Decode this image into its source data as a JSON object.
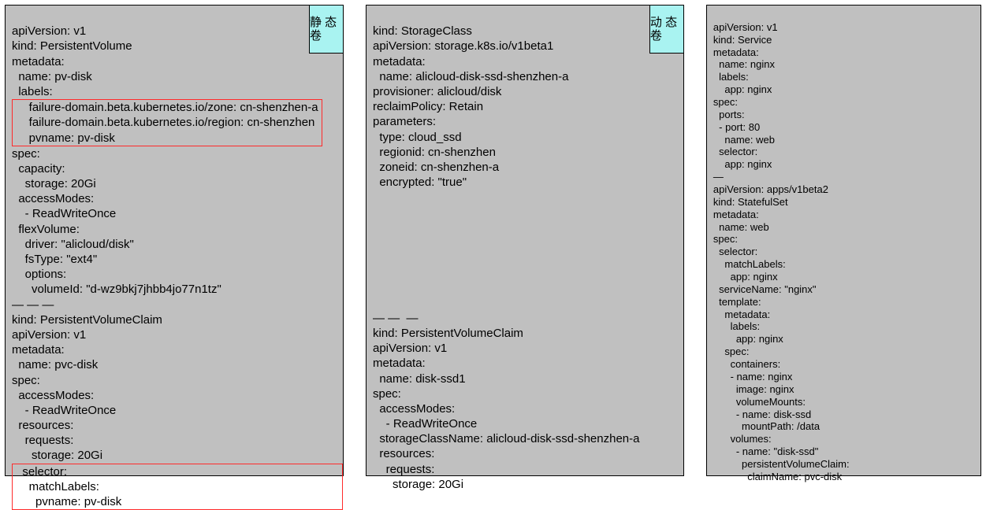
{
  "panel1": {
    "badge": "静\n态\n卷",
    "line01": "apiVersion: v1",
    "line02": "kind: PersistentVolume",
    "line03": "metadata:",
    "line04": "  name: pv-disk",
    "line05": "  labels:",
    "hl1a": "    failure-domain.beta.kubernetes.io/zone: cn-shenzhen-a",
    "hl1b": "    failure-domain.beta.kubernetes.io/region: cn-shenzhen",
    "hl1c": "    pvname: pv-disk",
    "line06": "spec:",
    "line07": "  capacity:",
    "line08": "    storage: 20Gi",
    "line09": "  accessModes:",
    "line10": "    - ReadWriteOnce",
    "line11": "  flexVolume:",
    "line12": "    driver: \"alicloud/disk\"",
    "line13": "    fsType: \"ext4\"",
    "line14": "    options:",
    "line15": "      volumeId: \"d-wz9bkj7jhbb4jo77n1tz\"",
    "sep1": "— — —",
    "line16": "kind: PersistentVolumeClaim",
    "line17": "apiVersion: v1",
    "line18": "metadata:",
    "line19": "  name: pvc-disk",
    "line20": "spec:",
    "line21": "  accessModes:",
    "line22": "    - ReadWriteOnce",
    "line23": "  resources:",
    "line24": "    requests:",
    "line25": "      storage: 20Gi",
    "hl2a": "  selector:",
    "hl2b": "    matchLabels:",
    "hl2c": "      pvname: pv-disk"
  },
  "panel2": {
    "badge": "动\n态\n卷",
    "line01": "kind: StorageClass",
    "line02": "apiVersion: storage.k8s.io/v1beta1",
    "line03": "metadata:",
    "line04": "  name: alicloud-disk-ssd-shenzhen-a",
    "line05": "provisioner: alicloud/disk",
    "line06": "reclaimPolicy: Retain",
    "line07": "parameters:",
    "line08": "  type: cloud_ssd",
    "line09": "  regionid: cn-shenzhen",
    "line10": "  zoneid: cn-shenzhen-a",
    "line11": "  encrypted: \"true\"",
    "sep1": "— —  —",
    "line12": "kind: PersistentVolumeClaim",
    "line13": "apiVersion: v1",
    "line14": "metadata:",
    "line15": "  name: disk-ssd1",
    "line16": "spec:",
    "line17": "  accessModes:",
    "line18": "    - ReadWriteOnce",
    "line19": "  storageClassName: alicloud-disk-ssd-shenzhen-a",
    "line20": "  resources:",
    "line21": "    requests:",
    "line22": "      storage: 20Gi"
  },
  "panel3": {
    "line01": "apiVersion: v1",
    "line02": "kind: Service",
    "line03": "metadata:",
    "line04": "  name: nginx",
    "line05": "  labels:",
    "line06": "    app: nginx",
    "line07": "spec:",
    "line08": "  ports:",
    "line09": "  - port: 80",
    "line10": "    name: web",
    "line11": "  selector:",
    "line12": "    app: nginx",
    "sep": "—",
    "line13": "apiVersion: apps/v1beta2",
    "line14": "kind: StatefulSet",
    "line15": "metadata:",
    "line16": "  name: web",
    "line17": "spec:",
    "line18": "  selector:",
    "line19": "    matchLabels:",
    "line20": "      app: nginx",
    "line21": "  serviceName: \"nginx\"",
    "line22": "  template:",
    "line23": "    metadata:",
    "line24": "      labels:",
    "line25": "        app: nginx",
    "line26": "    spec:",
    "line27": "      containers:",
    "line28": "      - name: nginx",
    "line29": "        image: nginx",
    "line30": "        volumeMounts:",
    "line31": "        - name: disk-ssd",
    "line32": "          mountPath: /data",
    "line33": "      volumes:",
    "line34": "        - name: \"disk-ssd\"",
    "line35": "          persistentVolumeClaim:",
    "line36": "            claimName: pvc-disk"
  }
}
